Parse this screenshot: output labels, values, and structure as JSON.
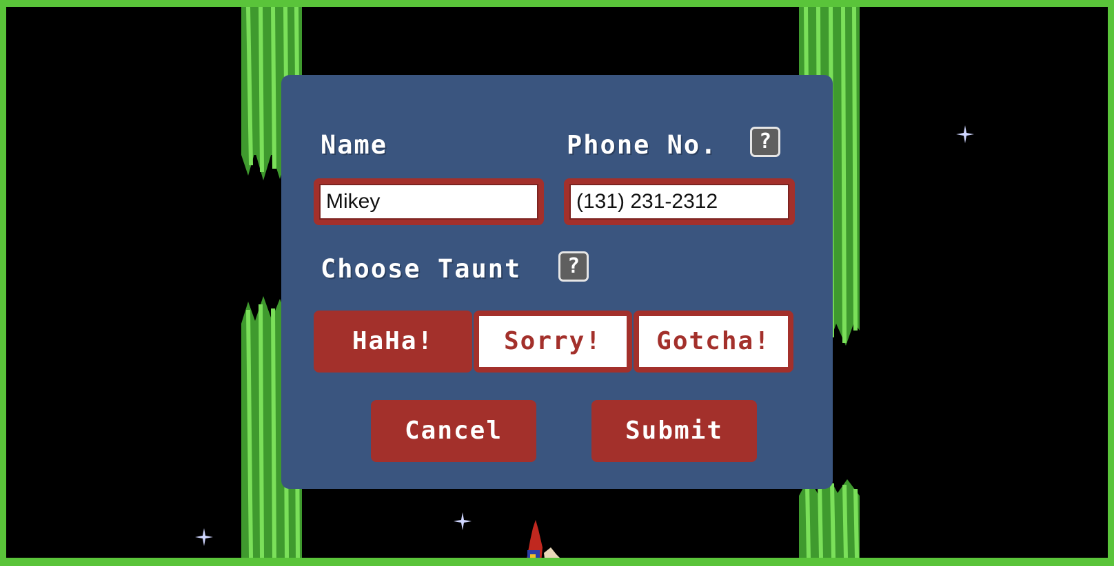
{
  "form": {
    "name_label": "Name",
    "phone_label": "Phone No.",
    "help_glyph": "?",
    "name_value": "Mikey",
    "phone_value": "(131) 231-2312",
    "taunt_label": "Choose Taunt"
  },
  "taunts": {
    "options": [
      "HaHa!",
      "Sorry!",
      "Gotcha!"
    ],
    "selected": "HaHa!"
  },
  "actions": {
    "cancel_label": "Cancel",
    "submit_label": "Submit"
  },
  "colors": {
    "border": "#5ac43a",
    "dialog": "#3a557f",
    "accent": "#a3302b"
  }
}
